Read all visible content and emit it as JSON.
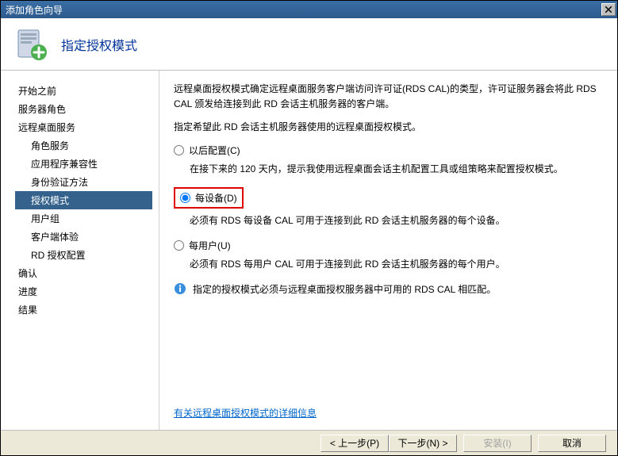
{
  "window": {
    "title": "添加角色向导"
  },
  "header": {
    "title": "指定授权模式"
  },
  "sidebar": {
    "items": [
      {
        "label": "开始之前",
        "indent": false
      },
      {
        "label": "服务器角色",
        "indent": false
      },
      {
        "label": "远程桌面服务",
        "indent": false
      },
      {
        "label": "角色服务",
        "indent": true
      },
      {
        "label": "应用程序兼容性",
        "indent": true
      },
      {
        "label": "身份验证方法",
        "indent": true
      },
      {
        "label": "授权模式",
        "indent": true,
        "selected": true
      },
      {
        "label": "用户组",
        "indent": true
      },
      {
        "label": "客户端体验",
        "indent": true
      },
      {
        "label": "RD 授权配置",
        "indent": true
      },
      {
        "label": "确认",
        "indent": false
      },
      {
        "label": "进度",
        "indent": false
      },
      {
        "label": "结果",
        "indent": false
      }
    ]
  },
  "main": {
    "para1": "远程桌面授权模式确定远程桌面服务客户端访问许可证(RDS CAL)的类型，许可证服务器会将此 RDS CAL 颁发给连接到此 RD 会话主机服务器的客户端。",
    "para2": "指定希望此 RD 会话主机服务器使用的远程桌面授权模式。",
    "options": [
      {
        "label": "以后配置(C)",
        "sub": "在接下来的 120 天内，提示我使用远程桌面会话主机配置工具或组策略来配置授权模式。",
        "checked": false
      },
      {
        "label": "每设备(D)",
        "sub": "必须有 RDS 每设备 CAL 可用于连接到此 RD 会话主机服务器的每个设备。",
        "checked": true,
        "highlight": true
      },
      {
        "label": "每用户(U)",
        "sub": "必须有 RDS 每用户 CAL 可用于连接到此 RD 会话主机服务器的每个用户。",
        "checked": false
      }
    ],
    "info": "指定的授权模式必须与远程桌面授权服务器中可用的 RDS CAL 相匹配。",
    "link": "有关远程桌面授权模式的详细信息"
  },
  "footer": {
    "prev": "< 上一步(P)",
    "next": "下一步(N) >",
    "install": "安装(I)",
    "cancel": "取消"
  }
}
